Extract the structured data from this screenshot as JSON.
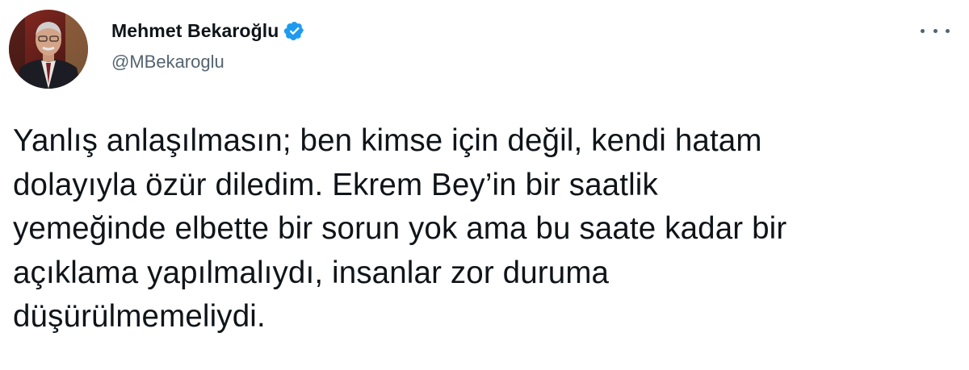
{
  "tweet": {
    "author": {
      "display_name": "Mehmet Bekaroğlu",
      "handle": "@MBekaroglu",
      "verified": true,
      "avatar_icon": "profile-photo"
    },
    "menu_icon": "more-horizontal-icon",
    "text_lines": [
      "Yanlış anlaşılmasın; ben kimse için değil, kendi hatam",
      "dolayıyla özür diledim. Ekrem Bey’in bir saatlik",
      "yemeğinde elbette bir sorun yok ama bu saate kadar bir",
      "açıklama yapılmalıydı, insanlar zor duruma",
      "düşürülmemeliydi."
    ]
  },
  "colors": {
    "verified_badge": "#1d9bf0",
    "handle_text": "#536471",
    "body_text": "#0f1419"
  }
}
